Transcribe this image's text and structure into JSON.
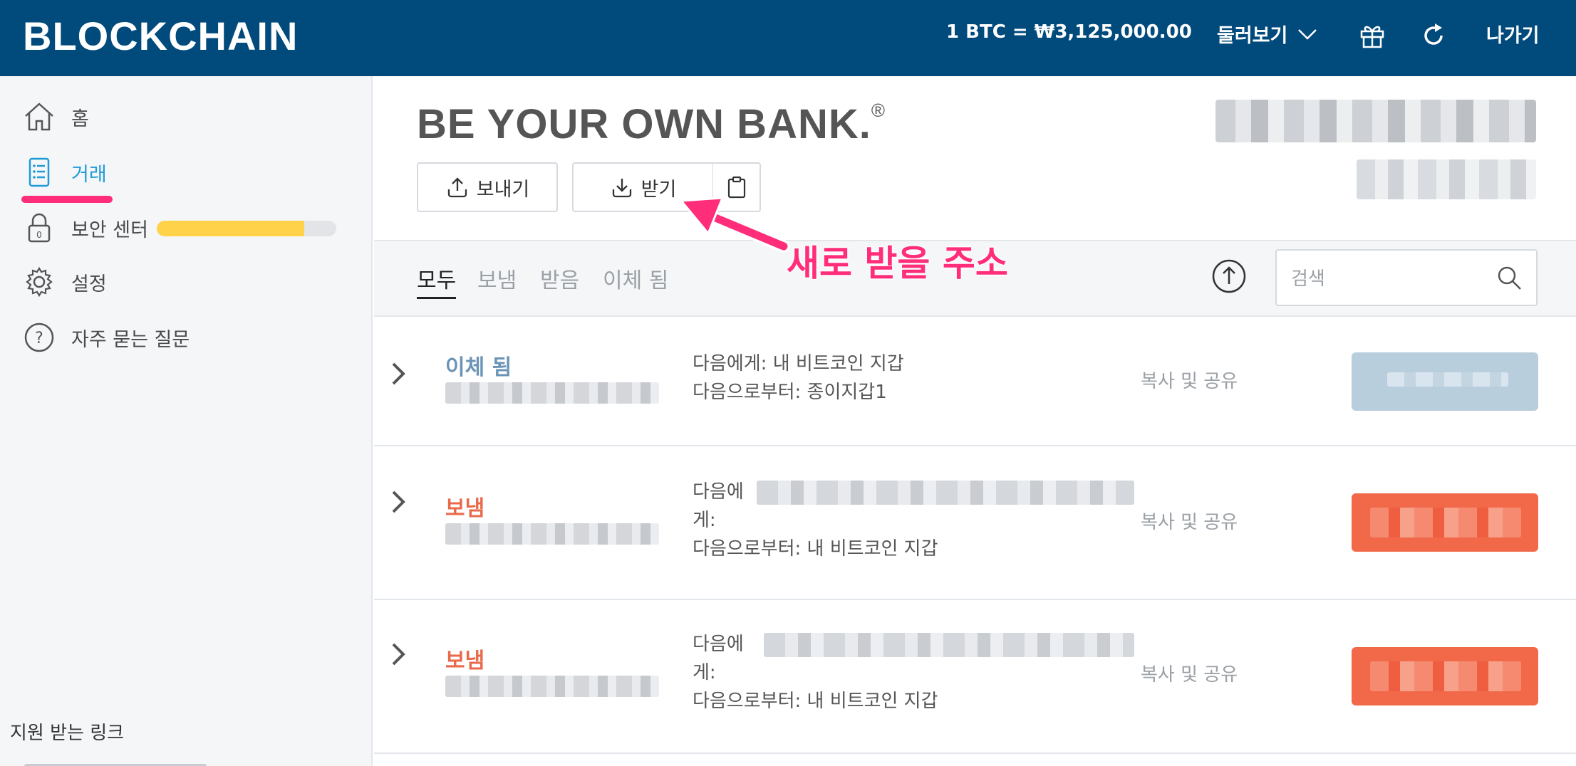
{
  "header": {
    "logo": "BLOCKCHAIN",
    "rate": "1 BTC =  ₩3,125,000.00",
    "explore": "둘러보기",
    "logout": "나가기",
    "icons": [
      "chevron-down-icon",
      "gift-icon",
      "refresh-icon"
    ]
  },
  "sidebar": {
    "items": [
      {
        "label": "홈",
        "icon": "home-icon"
      },
      {
        "label": "거래",
        "icon": "list-icon",
        "active": true
      },
      {
        "label": "보안 센터",
        "icon": "lock-icon",
        "progress": 0.82
      },
      {
        "label": "설정",
        "icon": "gear-icon"
      },
      {
        "label": "자주 묻는 질문",
        "icon": "question-icon"
      }
    ],
    "support": "지원 받는 링크",
    "colors": {
      "active": "#1e9ad6",
      "underline": "#ff2d7a",
      "progress": "#ffd24a"
    }
  },
  "main": {
    "tagline": "BE YOUR OWN BANK.",
    "tagline_mark": "®",
    "send": "보내기",
    "receive": "받기",
    "filters": [
      "모두",
      "보냄",
      "받음",
      "이체 됨"
    ],
    "search_placeholder": "검색"
  },
  "annotation": {
    "text": "새로 받을 주소",
    "color": "#ff2d7a"
  },
  "transactions": [
    {
      "type": "이체 됨",
      "to_label": "다음에게: 내 비트코인 지갑",
      "from_label": "다음으로부터: 종이지갑1",
      "share": "복사 및 공유",
      "color": "#b9cedd"
    },
    {
      "type": "보냄",
      "to_label": "다음에",
      "to_label_wrap": "게:",
      "from_label": "다음으로부터: 내 비트코인 지갑",
      "share": "복사 및 공유",
      "color": "#f2694a"
    },
    {
      "type": "보냄",
      "to_label": "다음에",
      "to_label_wrap": "게:",
      "from_label": "다음으로부터: 내 비트코인 지갑",
      "share": "복사 및 공유",
      "color": "#f2694a"
    }
  ]
}
